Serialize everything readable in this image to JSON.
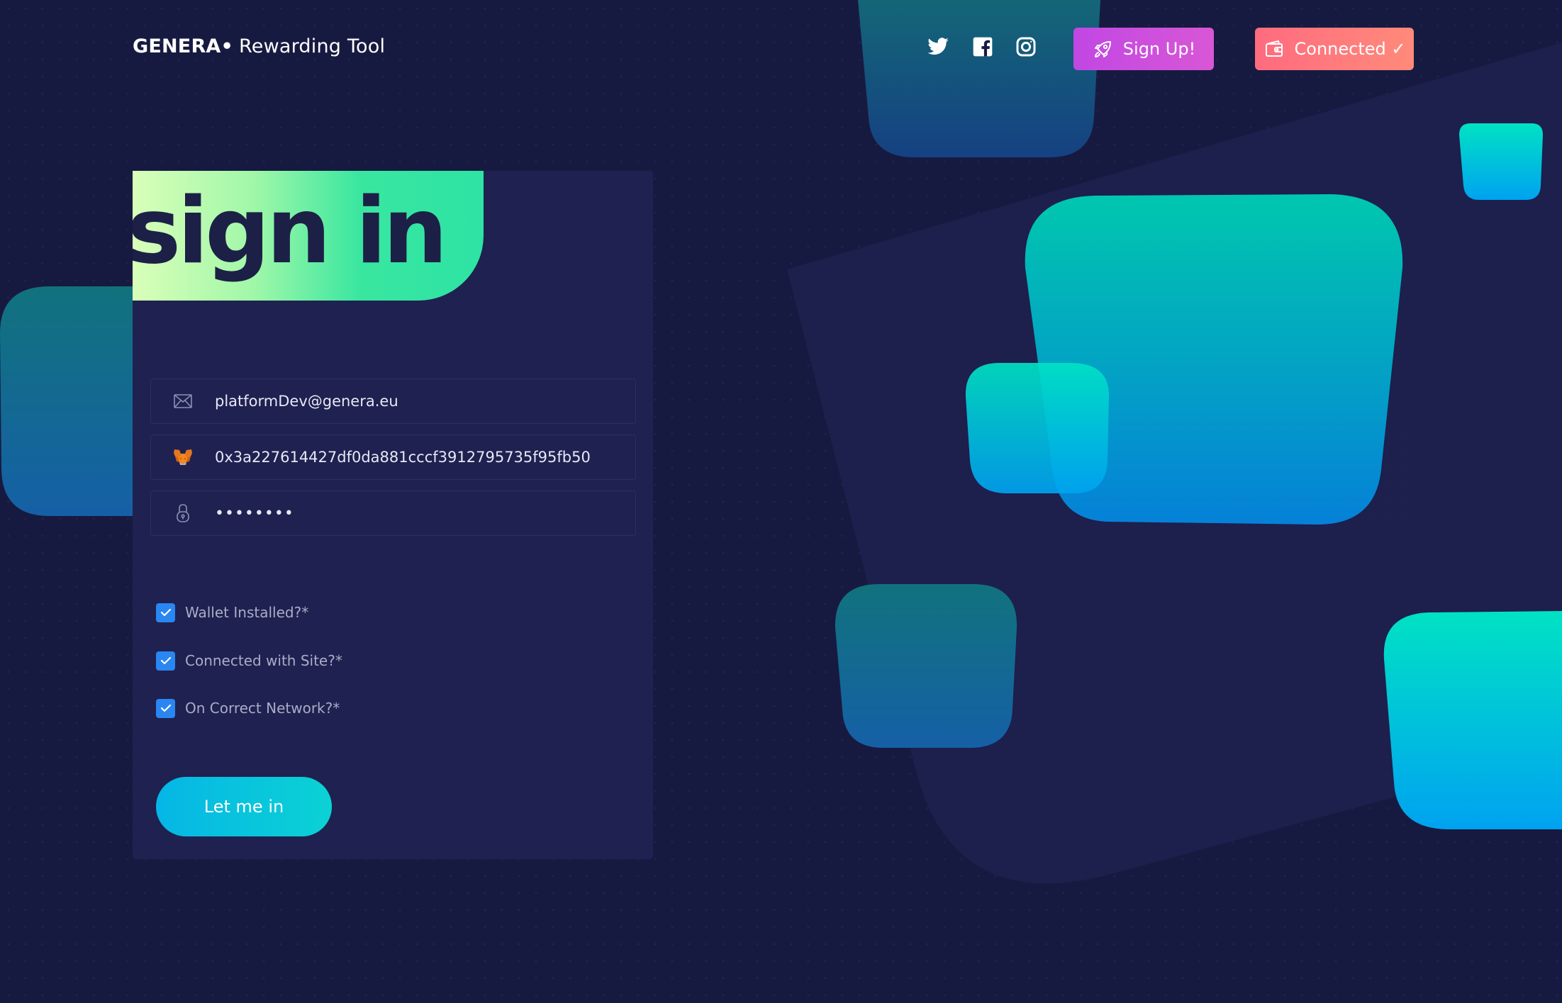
{
  "header": {
    "brand_name": "GENERA",
    "brand_dot": "•",
    "brand_subtitle": "Rewarding Tool",
    "social_links": [
      "twitter-icon",
      "facebook-icon",
      "instagram-icon"
    ],
    "signup_label": "Sign Up!",
    "signup_icon": "rocket-icon",
    "connected_label": "Connected ✓",
    "connected_icon": "wallet-icon"
  },
  "signin": {
    "title": "sign in",
    "email": {
      "icon": "envelope-icon",
      "value": "platformDev@genera.eu"
    },
    "wallet": {
      "icon": "metamask-fox-icon",
      "value": "0x3a227614427df0da881cccf3912795735f95fb50"
    },
    "password": {
      "icon": "lock-icon",
      "value": "••••••••"
    },
    "checks": [
      {
        "label": "Wallet Installed?*",
        "checked": true
      },
      {
        "label": "Connected with Site?*",
        "checked": true
      },
      {
        "label": "On Correct Network?*",
        "checked": true
      }
    ],
    "submit_label": "Let me in"
  },
  "colors": {
    "background": "#171a40",
    "card": "#1f2150",
    "banner_gradient": [
      "#d9ffb9",
      "#2ee3a4"
    ],
    "signup_button": "#c94de0",
    "connected_button": "#ff7a7d",
    "checkbox": "#2a86f0",
    "submit_gradient": [
      "#06b6e6",
      "#0bd2d4"
    ]
  }
}
